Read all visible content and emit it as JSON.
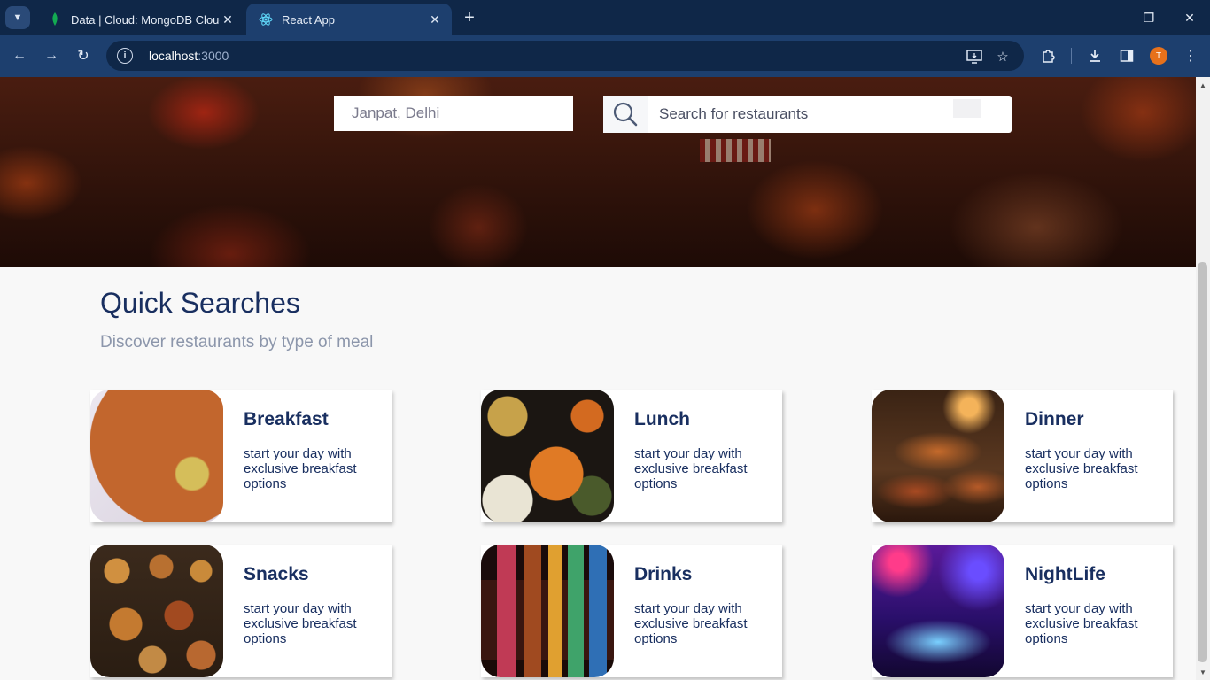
{
  "browser": {
    "tabs": [
      {
        "title": "Data | Cloud: MongoDB Cloud",
        "icon": "mongodb-leaf-icon",
        "active": false
      },
      {
        "title": "React App",
        "icon": "react-icon",
        "active": true
      }
    ],
    "url_host": "localhost",
    "url_port": ":3000",
    "profile_initial": "T",
    "colors": {
      "frame": "#0f2748",
      "toolbar": "#1d3f6e",
      "profile": "#e7711b"
    }
  },
  "hero": {
    "location_value": "Janpat, Delhi",
    "search_placeholder": "Search for restaurants"
  },
  "quick_searches": {
    "title": "Quick Searches",
    "subtitle": "Discover restaurants by type of meal",
    "cards": [
      {
        "title": "Breakfast",
        "description": "start your day with exclusive breakfast options"
      },
      {
        "title": "Lunch",
        "description": "start your day with exclusive breakfast options"
      },
      {
        "title": "Dinner",
        "description": "start your day with exclusive breakfast options"
      },
      {
        "title": "Snacks",
        "description": "start your day with exclusive breakfast options"
      },
      {
        "title": "Drinks",
        "description": "start your day with exclusive breakfast options"
      },
      {
        "title": "NightLife",
        "description": "start your day with exclusive breakfast options"
      }
    ]
  },
  "colors": {
    "heading": "#192f60",
    "subtitle": "#8c96ab"
  }
}
